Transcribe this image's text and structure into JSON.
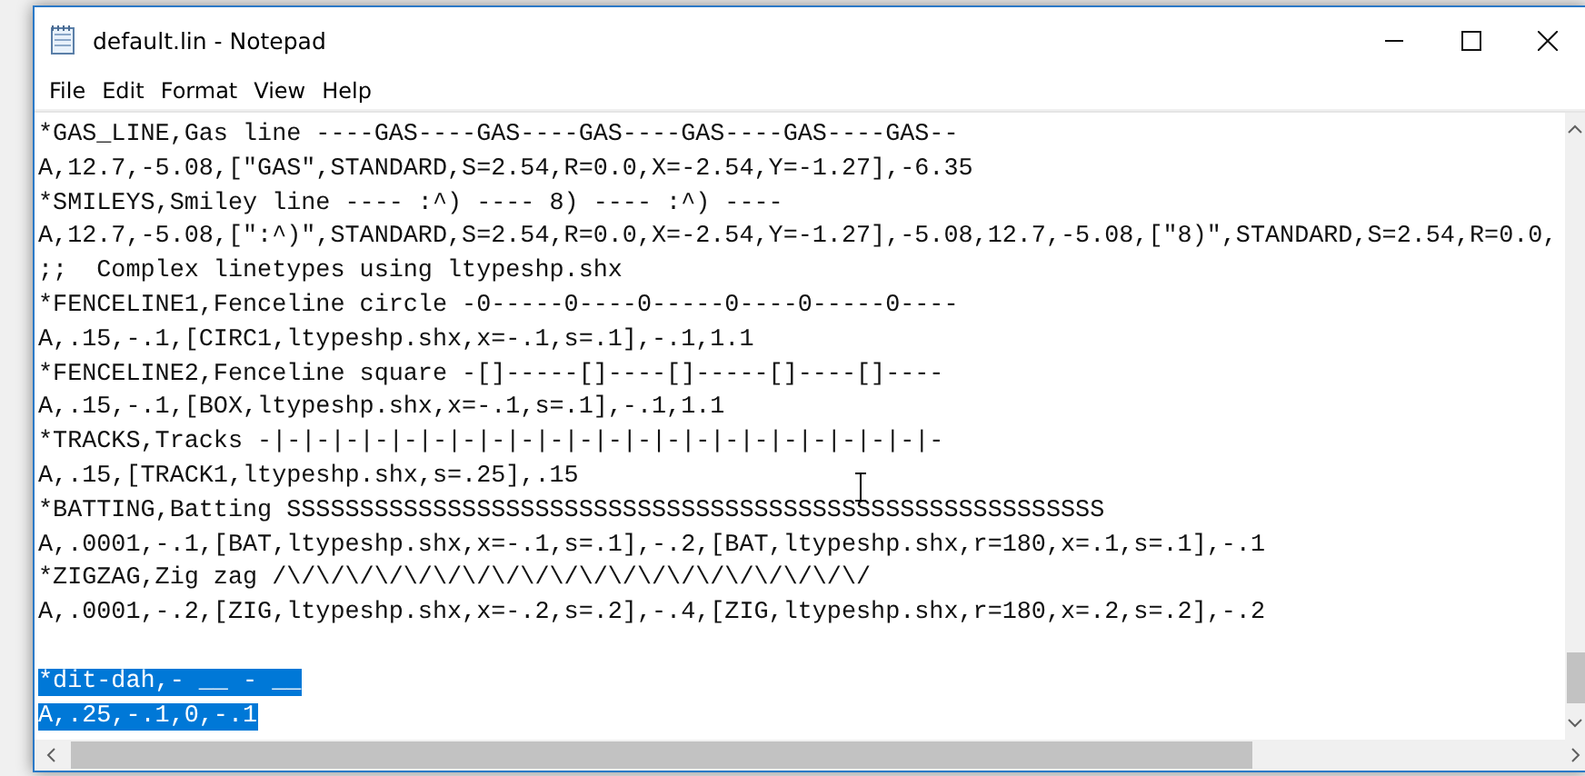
{
  "window": {
    "title": "default.lin - Notepad"
  },
  "menu": [
    {
      "label": "File"
    },
    {
      "label": "Edit"
    },
    {
      "label": "Format"
    },
    {
      "label": "View"
    },
    {
      "label": "Help"
    }
  ],
  "editor": {
    "paragraphs": [
      {
        "lines": [
          {
            "text": "*GAS_LINE,Gas line ----GAS----GAS----GAS----GAS----GAS----GAS--",
            "selected": false
          },
          {
            "text": "A,12.7,-5.08,[\"GAS\",STANDARD,S=2.54,R=0.0,X=-2.54,Y=-1.27],-6.35",
            "selected": false
          },
          {
            "text": "*SMILEYS,Smiley line ---- :^) ---- 8) ---- :^) ----",
            "selected": false
          },
          {
            "text": "A,12.7,-5.08,[\":^)\",STANDARD,S=2.54,R=0.0,X=-2.54,Y=-1.27],-5.08,12.7,-5.08,[\"8)\",STANDARD,S=2.54,R=0.0,",
            "selected": false
          },
          {
            "text": ";;  Complex linetypes using ltypeshp.shx",
            "selected": false
          },
          {
            "text": "*FENCELINE1,Fenceline circle -0-----0----0-----0----0-----0----",
            "selected": false
          },
          {
            "text": "A,.15,-.1,[CIRC1,ltypeshp.shx,x=-.1,s=.1],-.1,1.1",
            "selected": false
          },
          {
            "text": "*FENCELINE2,Fenceline square -[]-----[]----[]-----[]----[]----",
            "selected": false
          },
          {
            "text": "A,.15,-.1,[BOX,ltypeshp.shx,x=-.1,s=.1],-.1,1.1",
            "selected": false
          },
          {
            "text": "*TRACKS,Tracks -|-|-|-|-|-|-|-|-|-|-|-|-|-|-|-|-|-|-|-|-|-|-|-",
            "selected": false
          },
          {
            "text": "A,.15,[TRACK1,ltypeshp.shx,s=.25],.15",
            "selected": false
          },
          {
            "text": "*BATTING,Batting SSSSSSSSSSSSSSSSSSSSSSSSSSSSSSSSSSSSSSSSSSSSSSSSSSSSSSSS",
            "selected": false
          },
          {
            "text": "A,.0001,-.1,[BAT,ltypeshp.shx,x=-.1,s=.1],-.2,[BAT,ltypeshp.shx,r=180,x=.1,s=.1],-.1",
            "selected": false
          },
          {
            "text": "*ZIGZAG,Zig zag /\\/\\/\\/\\/\\/\\/\\/\\/\\/\\/\\/\\/\\/\\/\\/\\/\\/\\/\\/\\/",
            "selected": false
          },
          {
            "text": "A,.0001,-.2,[ZIG,ltypeshp.shx,x=-.2,s=.2],-.4,[ZIG,ltypeshp.shx,r=180,x=.2,s=.2],-.2",
            "selected": false
          }
        ]
      },
      {
        "lines": [
          {
            "text": "*dit-dah,- __ - __",
            "selected": true
          },
          {
            "text": "A,.25,-.1,0,-.1",
            "selected": true
          }
        ]
      }
    ]
  }
}
